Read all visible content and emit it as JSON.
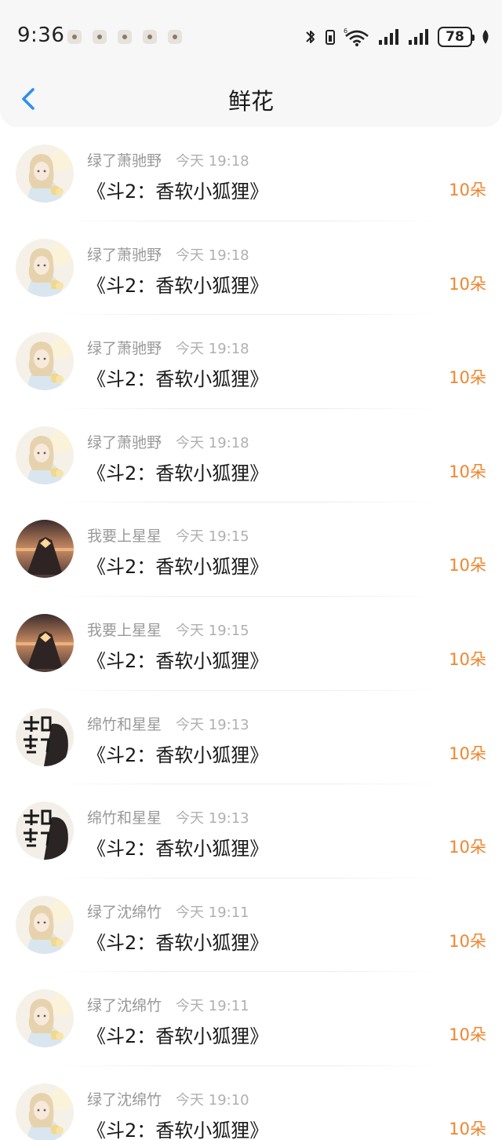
{
  "status_bar": {
    "time": "9:36",
    "battery": "78",
    "notification_icons": [
      "app-notification-icon",
      "app-notification-icon",
      "app-notification-icon",
      "app-notification-icon",
      "app-notification-icon"
    ],
    "system_icons": [
      "bluetooth-icon",
      "phone-vibrate-icon",
      "wifi-6-icon",
      "signal-icon",
      "signal-icon",
      "battery-icon",
      "leaf-icon"
    ]
  },
  "header": {
    "title": "鲜花",
    "back_icon": "chevron-left-icon"
  },
  "colors": {
    "accent_back": "#2e8ff0",
    "amount": "#f0852d",
    "meta_gray": "#999999"
  },
  "records": [
    {
      "user": "绿了萧驰野",
      "time": "今天 19:18",
      "book": "《斗2：香软小狐狸》",
      "amount": "10朵",
      "avatar": "anime-girl-avatar"
    },
    {
      "user": "绿了萧驰野",
      "time": "今天 19:18",
      "book": "《斗2：香软小狐狸》",
      "amount": "10朵",
      "avatar": "anime-girl-avatar"
    },
    {
      "user": "绿了萧驰野",
      "time": "今天 19:18",
      "book": "《斗2：香软小狐狸》",
      "amount": "10朵",
      "avatar": "anime-girl-avatar"
    },
    {
      "user": "绿了萧驰野",
      "time": "今天 19:18",
      "book": "《斗2：香软小狐狸》",
      "amount": "10朵",
      "avatar": "anime-girl-avatar"
    },
    {
      "user": "我要上星星",
      "time": "今天 19:15",
      "book": "《斗2：香软小狐狸》",
      "amount": "10朵",
      "avatar": "sunset-hands-avatar"
    },
    {
      "user": "我要上星星",
      "time": "今天 19:15",
      "book": "《斗2：香软小狐狸》",
      "amount": "10朵",
      "avatar": "sunset-hands-avatar"
    },
    {
      "user": "绵竹和星星",
      "time": "今天 19:13",
      "book": "《斗2：香软小狐狸》",
      "amount": "10朵",
      "avatar": "calligraphy-avatar"
    },
    {
      "user": "绵竹和星星",
      "time": "今天 19:13",
      "book": "《斗2：香软小狐狸》",
      "amount": "10朵",
      "avatar": "calligraphy-avatar"
    },
    {
      "user": "绿了沈绵竹",
      "time": "今天 19:11",
      "book": "《斗2：香软小狐狸》",
      "amount": "10朵",
      "avatar": "anime-girl-avatar"
    },
    {
      "user": "绿了沈绵竹",
      "time": "今天 19:11",
      "book": "《斗2：香软小狐狸》",
      "amount": "10朵",
      "avatar": "anime-girl-avatar"
    },
    {
      "user": "绿了沈绵竹",
      "time": "今天 19:10",
      "book": "《斗2：香软小狐狸》",
      "amount": "10朵",
      "avatar": "anime-girl-avatar"
    }
  ]
}
